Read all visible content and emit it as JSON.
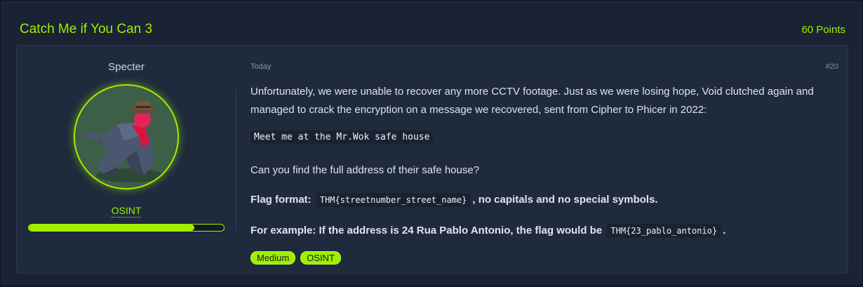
{
  "header": {
    "title": "Catch Me if You Can 3",
    "points": "60 Points"
  },
  "author": {
    "name": "Specter",
    "category_link": "OSINT",
    "progress_fraction": 0.85
  },
  "post": {
    "date": "Today",
    "number": "#20",
    "paragraph1": "Unfortunately, we were unable to recover any more CCTV footage. Just as we were losing hope, Void clutched again and managed to crack the encryption on a message we recovered, sent from Cipher to Phicer in 2022:",
    "code_message": "Meet me at the Mr.Wok safe house",
    "paragraph2": "Can you find the full address of their safe house?",
    "flag_format_label": "Flag format:",
    "flag_format_code": "THM{streetnumber_street_name}",
    "flag_format_suffix": ", no capitals and no special symbols.",
    "example_prefix": "For example: If the address is 24 Rua Pablo Antonio, the flag would be",
    "example_code": "THM{23_pablo_antonio}",
    "example_suffix": "."
  },
  "tags": [
    "Medium",
    "OSINT"
  ],
  "colors": {
    "accent": "#9fef00",
    "background": "#141a28",
    "card": "#1f2a3d"
  }
}
